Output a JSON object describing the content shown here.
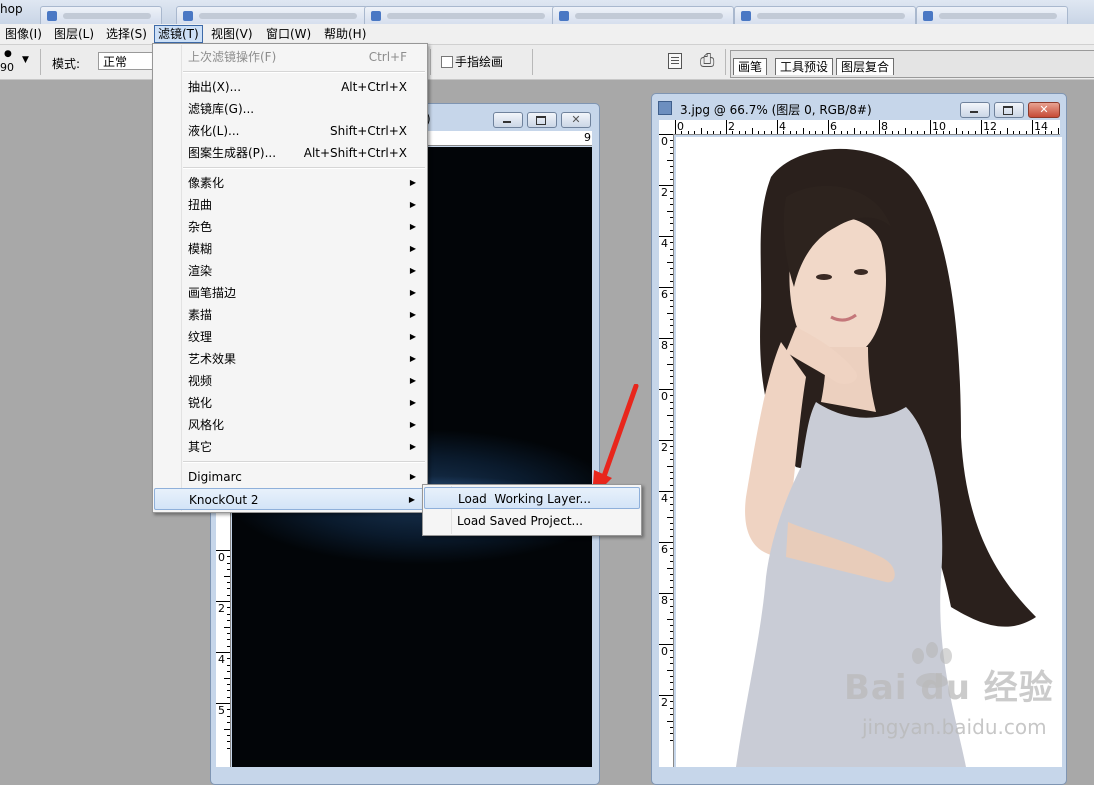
{
  "app": {
    "title_fragment": "hop"
  },
  "menubar": [
    {
      "label": "图像(I)",
      "active": false
    },
    {
      "label": "图层(L)",
      "active": false
    },
    {
      "label": "选择(S)",
      "active": false
    },
    {
      "label": "滤镜(T)",
      "active": true
    },
    {
      "label": "视图(V)",
      "active": false
    },
    {
      "label": "窗口(W)",
      "active": false
    },
    {
      "label": "帮助(H)",
      "active": false
    }
  ],
  "options": {
    "brush_size": "90",
    "mode_label": "模式:",
    "mode_value": "正常",
    "finger_paint_label": "手指绘画",
    "finger_paint_checked": false,
    "palette_tabs": [
      "画笔",
      "工具预设",
      "图层复合"
    ]
  },
  "filter_menu": {
    "items": [
      {
        "label": "上次滤镜操作(F)",
        "shortcut": "Ctrl+F",
        "disabled": true
      },
      {
        "separator": true
      },
      {
        "label": "抽出(X)...",
        "shortcut": "Alt+Ctrl+X"
      },
      {
        "label": "滤镜库(G)...",
        "shortcut": ""
      },
      {
        "label": "液化(L)...",
        "shortcut": "Shift+Ctrl+X"
      },
      {
        "label": "图案生成器(P)...",
        "shortcut": "Alt+Shift+Ctrl+X"
      },
      {
        "separator": true
      },
      {
        "label": "像素化",
        "submenu": true
      },
      {
        "label": "扭曲",
        "submenu": true
      },
      {
        "label": "杂色",
        "submenu": true
      },
      {
        "label": "模糊",
        "submenu": true
      },
      {
        "label": "渲染",
        "submenu": true
      },
      {
        "label": "画笔描边",
        "submenu": true
      },
      {
        "label": "素描",
        "submenu": true
      },
      {
        "label": "纹理",
        "submenu": true
      },
      {
        "label": "艺术效果",
        "submenu": true
      },
      {
        "label": "视频",
        "submenu": true
      },
      {
        "label": "锐化",
        "submenu": true
      },
      {
        "label": "风格化",
        "submenu": true
      },
      {
        "label": "其它",
        "submenu": true
      },
      {
        "separator": true
      },
      {
        "label": "Digimarc",
        "submenu": true
      },
      {
        "label": "KnockOut 2",
        "submenu": true,
        "highlighted": true
      }
    ]
  },
  "knockout_submenu": {
    "items": [
      {
        "label": "Load  Working Layer...",
        "highlighted": true
      },
      {
        "label": "Load Saved Project...",
        "highlighted": false
      }
    ]
  },
  "doc_right": {
    "title": "3.jpg @ 66.7% (图层 0, RGB/8#)",
    "ruler_h": [
      "0",
      "2",
      "4",
      "6",
      "8",
      "10",
      "12",
      "14"
    ],
    "ruler_v": [
      "0",
      "2",
      "4",
      "6",
      "8",
      "0",
      "2",
      "4",
      "6",
      "8",
      "0",
      "2"
    ]
  },
  "doc_left": {
    "title_fragment": ")",
    "ruler_v": [
      "0",
      "2",
      "4",
      "5"
    ]
  },
  "watermark": {
    "brand": "Bai du 经验",
    "url": "jingyan.baidu.com"
  },
  "colors": {
    "menu_highlight": "#d4e4f7",
    "arrow": "#e8261c",
    "window_frame": "#c6d6ea"
  }
}
